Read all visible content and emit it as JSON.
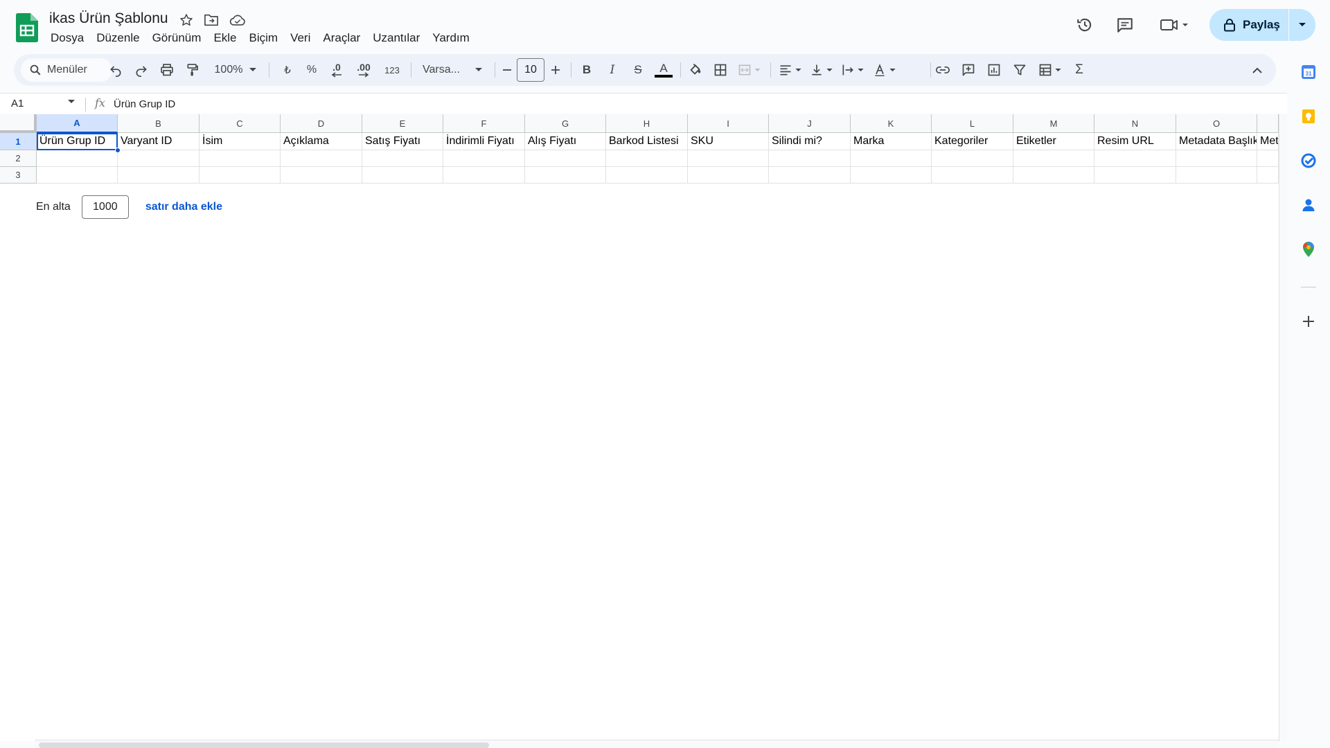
{
  "document": {
    "title": "ikas Ürün Şablonu"
  },
  "menu": [
    "Dosya",
    "Düzenle",
    "Görünüm",
    "Ekle",
    "Biçim",
    "Veri",
    "Araçlar",
    "Uzantılar",
    "Yardım"
  ],
  "header": {
    "share_label": "Paylaş"
  },
  "toolbar": {
    "search_label": "Menüler",
    "zoom": "100%",
    "currency": "₺",
    "percent": "%",
    "dec_decrease": ".0",
    "dec_increase": ".00",
    "number_format": "123",
    "font": "Varsa...",
    "font_size": "10",
    "bold": "B",
    "italic": "I",
    "strike": "S",
    "text_color": "A",
    "function_label": "Σ"
  },
  "formula_bar": {
    "cell_ref": "A1",
    "fx": "fx",
    "content": "Ürün Grup ID"
  },
  "grid": {
    "columns": [
      "A",
      "B",
      "C",
      "D",
      "E",
      "F",
      "G",
      "H",
      "I",
      "J",
      "K",
      "L",
      "M",
      "N",
      "O"
    ],
    "rows": [
      "1",
      "2",
      "3"
    ],
    "row1": [
      "Ürün Grup ID",
      "Varyant ID",
      "İsim",
      "Açıklama",
      "Satış Fiyatı",
      "İndirimli Fiyatı",
      "Alış Fiyatı",
      "Barkod Listesi",
      "SKU",
      "Silindi mi?",
      "Marka",
      "Kategoriler",
      "Etiketler",
      "Resim URL",
      "Metadata Başlık",
      "Met"
    ]
  },
  "add_rows": {
    "prefix": "En alta",
    "count": "1000",
    "link": "satır daha ekle"
  },
  "colors": {
    "accent": "#0b57d0",
    "share_bg": "#c2e7ff",
    "sheets_green": "#0f9d58"
  }
}
